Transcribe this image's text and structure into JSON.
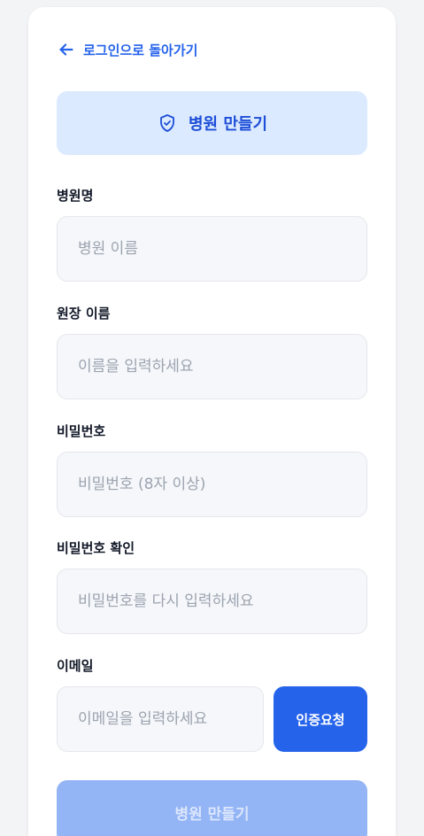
{
  "header": {
    "back_label": "로그인으로 돌아가기",
    "back_icon": "arrow-left-icon"
  },
  "banner": {
    "title": "병원 만들기",
    "icon": "shield-check-icon"
  },
  "form": {
    "hospital_name": {
      "label": "병원명",
      "placeholder": "병원 이름",
      "value": ""
    },
    "director_name": {
      "label": "원장 이름",
      "placeholder": "이름을 입력하세요",
      "value": ""
    },
    "password": {
      "label": "비밀번호",
      "placeholder": "비밀번호 (8자 이상)",
      "value": ""
    },
    "password_confirm": {
      "label": "비밀번호 확인",
      "placeholder": "비밀번호를 다시 입력하세요",
      "value": ""
    },
    "email": {
      "label": "이메일",
      "placeholder": "이메일을 입력하세요",
      "value": ""
    },
    "verify_label": "인증요청",
    "submit_label": "병원 만들기"
  },
  "colors": {
    "accent": "#2563eb",
    "banner_bg": "#dbeafe",
    "submit_disabled_bg": "#93b4f5",
    "field_bg": "#f5f7fa"
  }
}
